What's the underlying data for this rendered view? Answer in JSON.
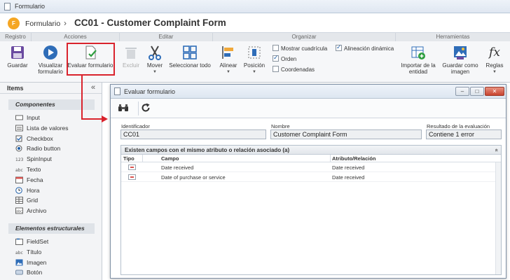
{
  "window": {
    "title": "Formulario"
  },
  "header": {
    "breadcrumb": "Formulario",
    "separator": "›",
    "page_title": "CC01 - Customer Complaint Form",
    "app_icon_letter": "F"
  },
  "ribbon": {
    "groups": [
      "Registro",
      "Acciones",
      "Editar",
      "Organizar",
      "Herramientas"
    ],
    "buttons": {
      "guardar": "Guardar",
      "visualizar_1": "Visualizar",
      "visualizar_2": "formulario",
      "evaluar": "Evaluar formulario",
      "excluir": "Excluir",
      "mover": "Mover",
      "seleccionar": "Seleccionar todo",
      "alinear": "Alinear",
      "posicion": "Posición",
      "importar_1": "Importar de la",
      "importar_2": "entidad",
      "guardar_imagen_1": "Guardar como",
      "guardar_imagen_2": "imagen",
      "reglas": "Reglas"
    },
    "checks": [
      {
        "label": "Mostrar cuadrícula",
        "checked": false
      },
      {
        "label": "Orden",
        "checked": true
      },
      {
        "label": "Coordenadas",
        "checked": false
      },
      {
        "label": "Alineación dinámica",
        "checked": true
      }
    ]
  },
  "leftpanel": {
    "title": "Items",
    "collapse": "«",
    "sections": [
      {
        "title": "Componentes",
        "items": [
          "Input",
          "Lista de valores",
          "Checkbox",
          "Radio button",
          "SpinInput",
          "Texto",
          "Fecha",
          "Hora",
          "Grid",
          "Archivo"
        ]
      },
      {
        "title": "Elementos estructurales",
        "items": [
          "FieldSet",
          "Título",
          "Imagen",
          "Botón"
        ]
      }
    ]
  },
  "dialog": {
    "title": "Evaluar formulario",
    "fields": {
      "identificador_label": "Identificador",
      "identificador_value": "CC01",
      "nombre_label": "Nombre",
      "nombre_value": "Customer Complaint Form",
      "resultado_label": "Resultado de la evaluación",
      "resultado_value": "Contiene 1 error"
    },
    "panel": {
      "title": "Existen campos con el mismo atributo o relación asociado (a)",
      "collapse": "«",
      "columns": [
        "Tipo",
        "Campo",
        "Atributo/Relación"
      ],
      "rows": [
        {
          "campo": "Date received",
          "atributo": "Date received"
        },
        {
          "campo": "Date of purchase or service",
          "atributo": "Date received"
        }
      ]
    },
    "window_buttons": {
      "minimize": "–",
      "maximize": "□",
      "close": "✕"
    }
  },
  "colors": {
    "accent_red": "#d9232d",
    "brand_orange": "#f5a623",
    "check_green": "#2e9e3f"
  }
}
